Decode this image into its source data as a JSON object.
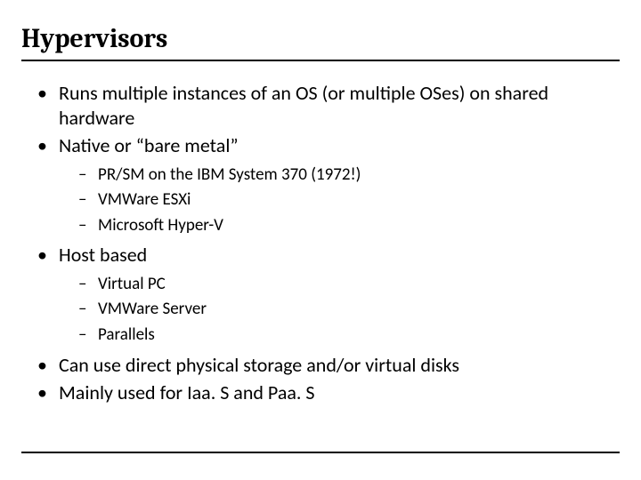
{
  "title": "Hypervisors",
  "bullets": {
    "b0": "Runs multiple instances of an OS (or multiple OSes) on shared hardware",
    "b1": "Native or “bare metal”",
    "b1_sub": {
      "s0": "PR/SM on the IBM System 370 (1972!)",
      "s1": "VMWare ESXi",
      "s2": "Microsoft Hyper-V"
    },
    "b2": "Host based",
    "b2_sub": {
      "s0": "Virtual PC",
      "s1": "VMWare Server",
      "s2": "Parallels"
    },
    "b3": "Can use direct physical storage and/or virtual disks",
    "b4": "Mainly used for Iaa. S and Paa. S"
  }
}
